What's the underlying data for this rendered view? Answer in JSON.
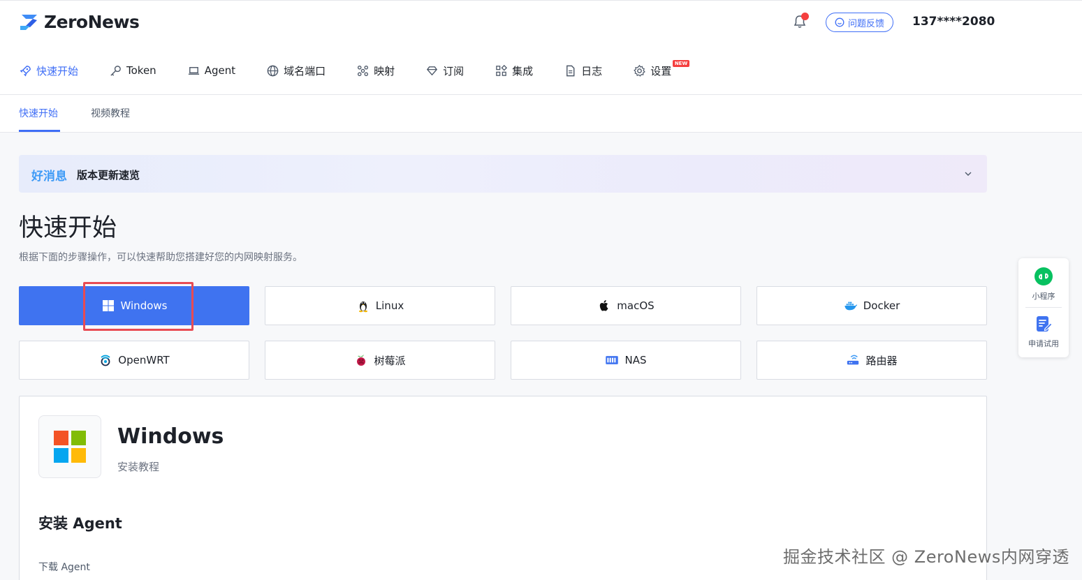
{
  "brand": {
    "name": "ZeroNews",
    "accent": "#3f6ef6"
  },
  "header": {
    "feedback_label": "问题反馈",
    "phone": "137****2080"
  },
  "nav": {
    "items": [
      {
        "label": "快速开始",
        "icon": "rocket-icon",
        "active": true
      },
      {
        "label": "Token",
        "icon": "key-icon"
      },
      {
        "label": "Agent",
        "icon": "laptop-icon"
      },
      {
        "label": "域名端口",
        "icon": "globe-icon"
      },
      {
        "label": "映射",
        "icon": "mapping-icon"
      },
      {
        "label": "订阅",
        "icon": "diamond-icon"
      },
      {
        "label": "集成",
        "icon": "apps-icon"
      },
      {
        "label": "日志",
        "icon": "document-icon"
      },
      {
        "label": "设置",
        "icon": "gear-icon",
        "badge": "NEW"
      }
    ]
  },
  "subtabs": [
    {
      "label": "快速开始",
      "active": true
    },
    {
      "label": "视频教程"
    }
  ],
  "banner": {
    "highlight": "好消息",
    "text": "版本更新速览"
  },
  "page": {
    "title": "快速开始",
    "description": "根据下面的步骤操作，可以快速帮助您搭建好您的内网映射服务。"
  },
  "platforms": [
    {
      "label": "Windows",
      "icon": "windows-icon",
      "active": true
    },
    {
      "label": "Linux",
      "icon": "linux-icon"
    },
    {
      "label": "macOS",
      "icon": "apple-icon"
    },
    {
      "label": "Docker",
      "icon": "docker-icon"
    },
    {
      "label": "OpenWRT",
      "icon": "openwrt-icon"
    },
    {
      "label": "树莓派",
      "icon": "raspberry-icon"
    },
    {
      "label": "NAS",
      "icon": "nas-icon"
    },
    {
      "label": "路由器",
      "icon": "router-icon"
    }
  ],
  "card": {
    "title": "Windows",
    "subtitle": "安装教程",
    "section_title": "安装 Agent",
    "section_sub": "下载 Agent"
  },
  "side_panel": {
    "items": [
      {
        "label": "小程序",
        "icon": "miniprogram-icon"
      },
      {
        "label": "申请试用",
        "icon": "apply-trial-icon"
      }
    ]
  },
  "watermark": "掘金技术社区 @ ZeroNews内网穿透"
}
